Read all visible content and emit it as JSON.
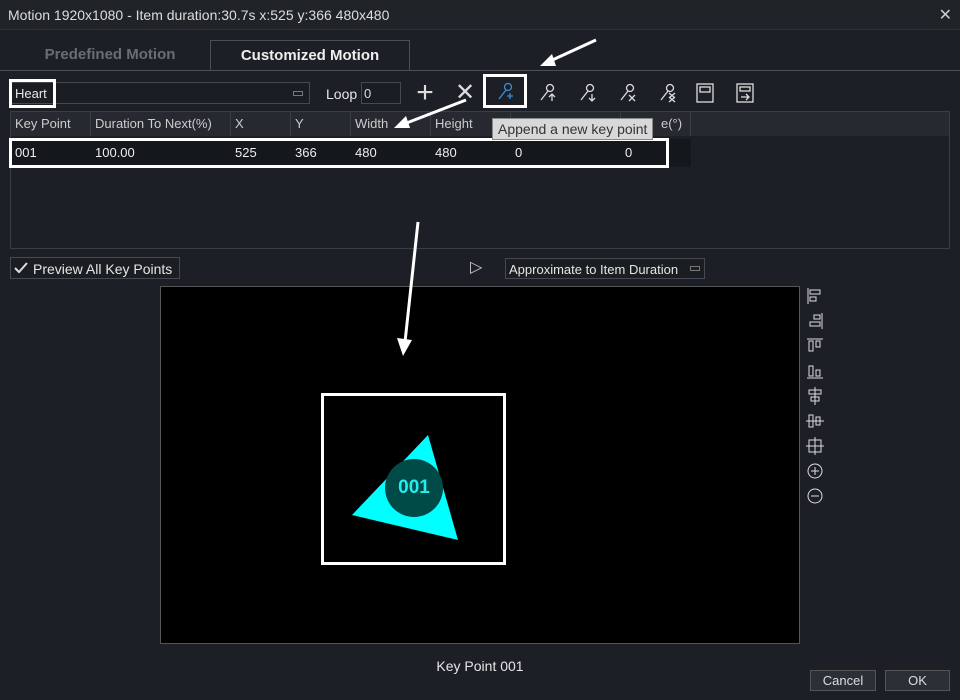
{
  "window": {
    "title": "Motion 1920x1080 - Item duration:30.7s x:525 y:366 480x480",
    "close_icon": "close-icon"
  },
  "tabs": [
    {
      "label": "Predefined Motion",
      "active": false
    },
    {
      "label": "Customized Motion",
      "active": true
    }
  ],
  "toolbar": {
    "motion_name": "Heart",
    "loop_label": "Loop",
    "loop_value": "0",
    "tooltip": "Append a new key point",
    "icons": [
      "plus-icon",
      "delete-icon",
      "append-key-point-icon",
      "insert-key-point-before-icon",
      "insert-key-point-after-icon",
      "remove-key-point-icon",
      "remove-all-key-points-icon",
      "save-template-icon",
      "export-template-icon"
    ]
  },
  "table": {
    "headers": [
      "Key Point",
      "Duration To Next(%)",
      "X",
      "Y",
      "Width",
      "Height",
      "",
      "e(°)"
    ],
    "rows": [
      [
        "001",
        "100.00",
        "525",
        "366",
        "480",
        "480",
        "0",
        "0"
      ]
    ]
  },
  "preview": {
    "checkbox_label": "Preview All Key Points",
    "checked": true,
    "approx_label": "Approximate to Item Duration",
    "key_point_badge": "001",
    "key_point_caption": "Key Point 001"
  },
  "shape_color": "#00ffff",
  "buttons": {
    "cancel": "Cancel",
    "ok": "OK"
  }
}
